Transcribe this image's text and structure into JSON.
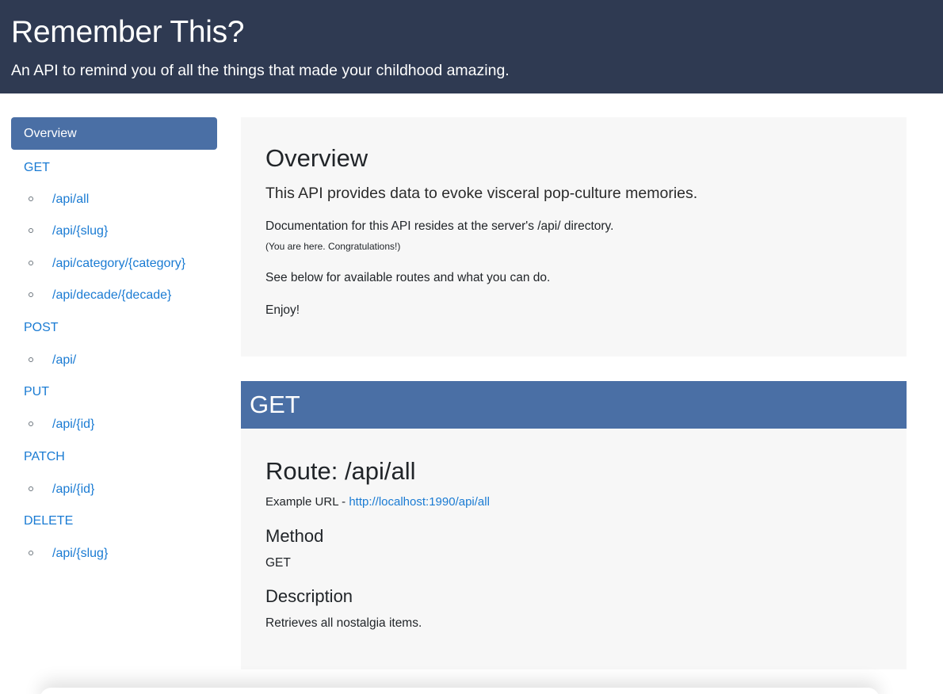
{
  "header": {
    "title": "Remember This?",
    "subtitle": "An API to remind you of all the things that made your childhood amazing."
  },
  "sidebar": {
    "active_label": "Overview",
    "groups": [
      {
        "method": "GET",
        "routes": [
          "/api/all",
          "/api/{slug}",
          "/api/category/{category}",
          "/api/decade/{decade}"
        ]
      },
      {
        "method": "POST",
        "routes": [
          "/api/"
        ]
      },
      {
        "method": "PUT",
        "routes": [
          "/api/{id}"
        ]
      },
      {
        "method": "PATCH",
        "routes": [
          "/api/{id}"
        ]
      },
      {
        "method": "DELETE",
        "routes": [
          "/api/{slug}"
        ]
      }
    ]
  },
  "overview": {
    "heading": "Overview",
    "lead": "This API provides data to evoke visceral pop-culture memories.",
    "doc_line": "Documentation for this API resides at the server's /api/ directory.",
    "note": "(You are here. Congratulations!)",
    "routes_line": "See below for available routes and what you can do.",
    "enjoy": "Enjoy!"
  },
  "get_section": {
    "bar_label": "GET",
    "route_heading": "Route: /api/all",
    "example_prefix": "Example URL - ",
    "example_url": "http://localhost:1990/api/all",
    "method_heading": "Method",
    "method_value": "GET",
    "description_heading": "Description",
    "description_value": "Retrieves all nostalgia items."
  },
  "colors": {
    "header_bg": "#2f3a52",
    "accent": "#4a6fa5",
    "link": "#1a7bd3",
    "card_bg": "#f7f7f7"
  }
}
